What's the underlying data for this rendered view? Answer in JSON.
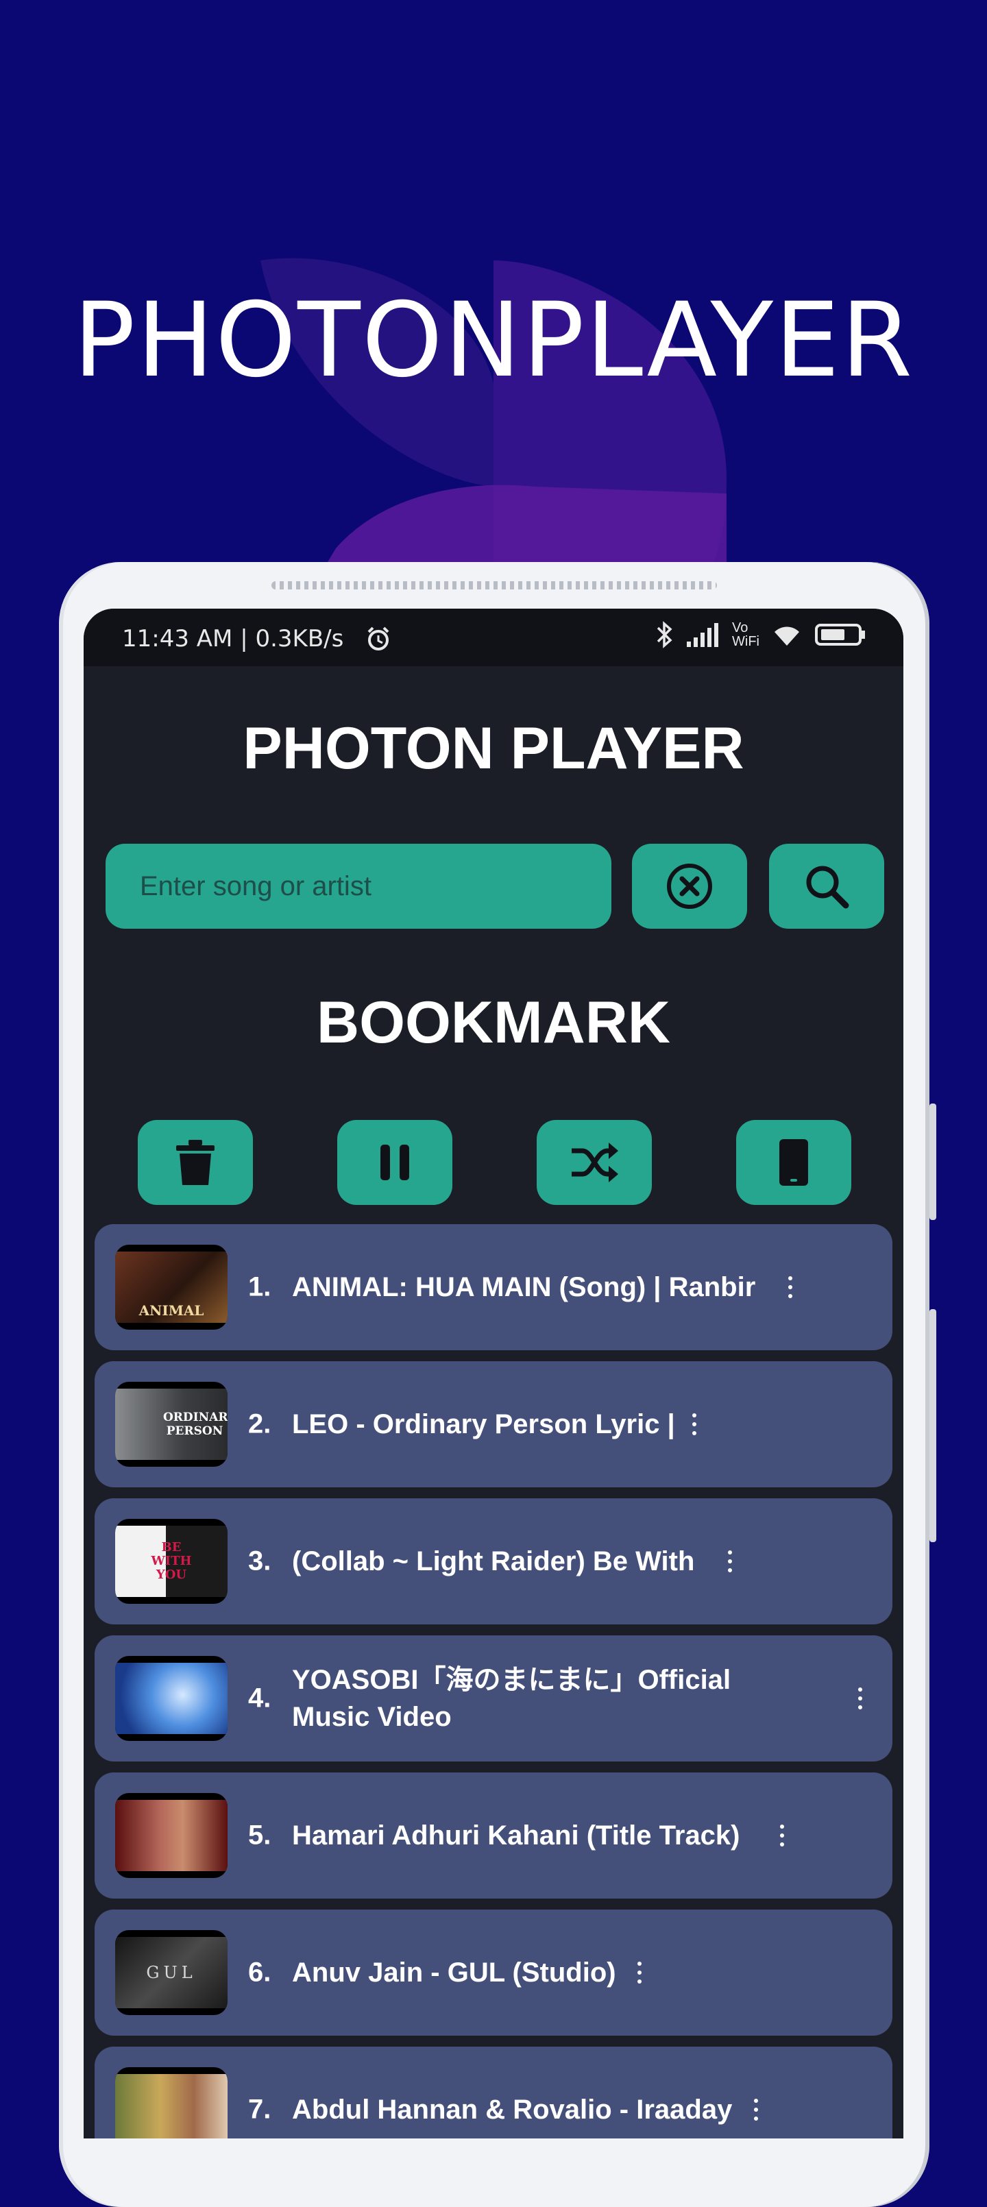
{
  "promo": {
    "title": "PHOTONPLAYER"
  },
  "status_bar": {
    "time_speed": "11:43 AM | 0.3KB/s",
    "alarm_icon": "alarm-clock-icon",
    "bluetooth_icon": "bluetooth-icon",
    "signal_icon": "signal-bars-icon",
    "vowifi": "Vo\nWiFi",
    "wifi_icon": "wifi-icon",
    "battery_icon": "battery-icon"
  },
  "app": {
    "title": "PHOTON PLAYER",
    "search": {
      "placeholder": "Enter song or artist",
      "value": ""
    },
    "section_title": "BOOKMARK"
  },
  "controls": [
    {
      "name": "delete",
      "icon": "trash-icon"
    },
    {
      "name": "pause",
      "icon": "pause-icon"
    },
    {
      "name": "shuffle",
      "icon": "shuffle-icon"
    },
    {
      "name": "device",
      "icon": "phone-icon"
    }
  ],
  "bookmarks": [
    {
      "num": "1.",
      "title": "ANIMAL: HUA MAIN (Song) | Ranbir",
      "thumb_text": "ANIMAL"
    },
    {
      "num": "2.",
      "title": "LEO - Ordinary Person Lyric |",
      "thumb_text": "ORDINARY PERSON"
    },
    {
      "num": "3.",
      "title": "(Collab ~ Light Raider) Be With",
      "thumb_text": "BE WITH YOU"
    },
    {
      "num": "4.",
      "title": "YOASOBI「海のまにまに」Official Music Video",
      "thumb_text": ""
    },
    {
      "num": "5.",
      "title": "Hamari Adhuri Kahani (Title Track)",
      "thumb_text": ""
    },
    {
      "num": "6.",
      "title": "Anuv Jain - GUL (Studio)",
      "thumb_text": "GUL"
    },
    {
      "num": "7.",
      "title": "Abdul Hannan & Rovalio - Iraaday",
      "thumb_text": ""
    }
  ],
  "colors": {
    "background": "#0b0874",
    "screen": "#1c1e27",
    "accent": "#26a58f",
    "row": "#44507a"
  }
}
